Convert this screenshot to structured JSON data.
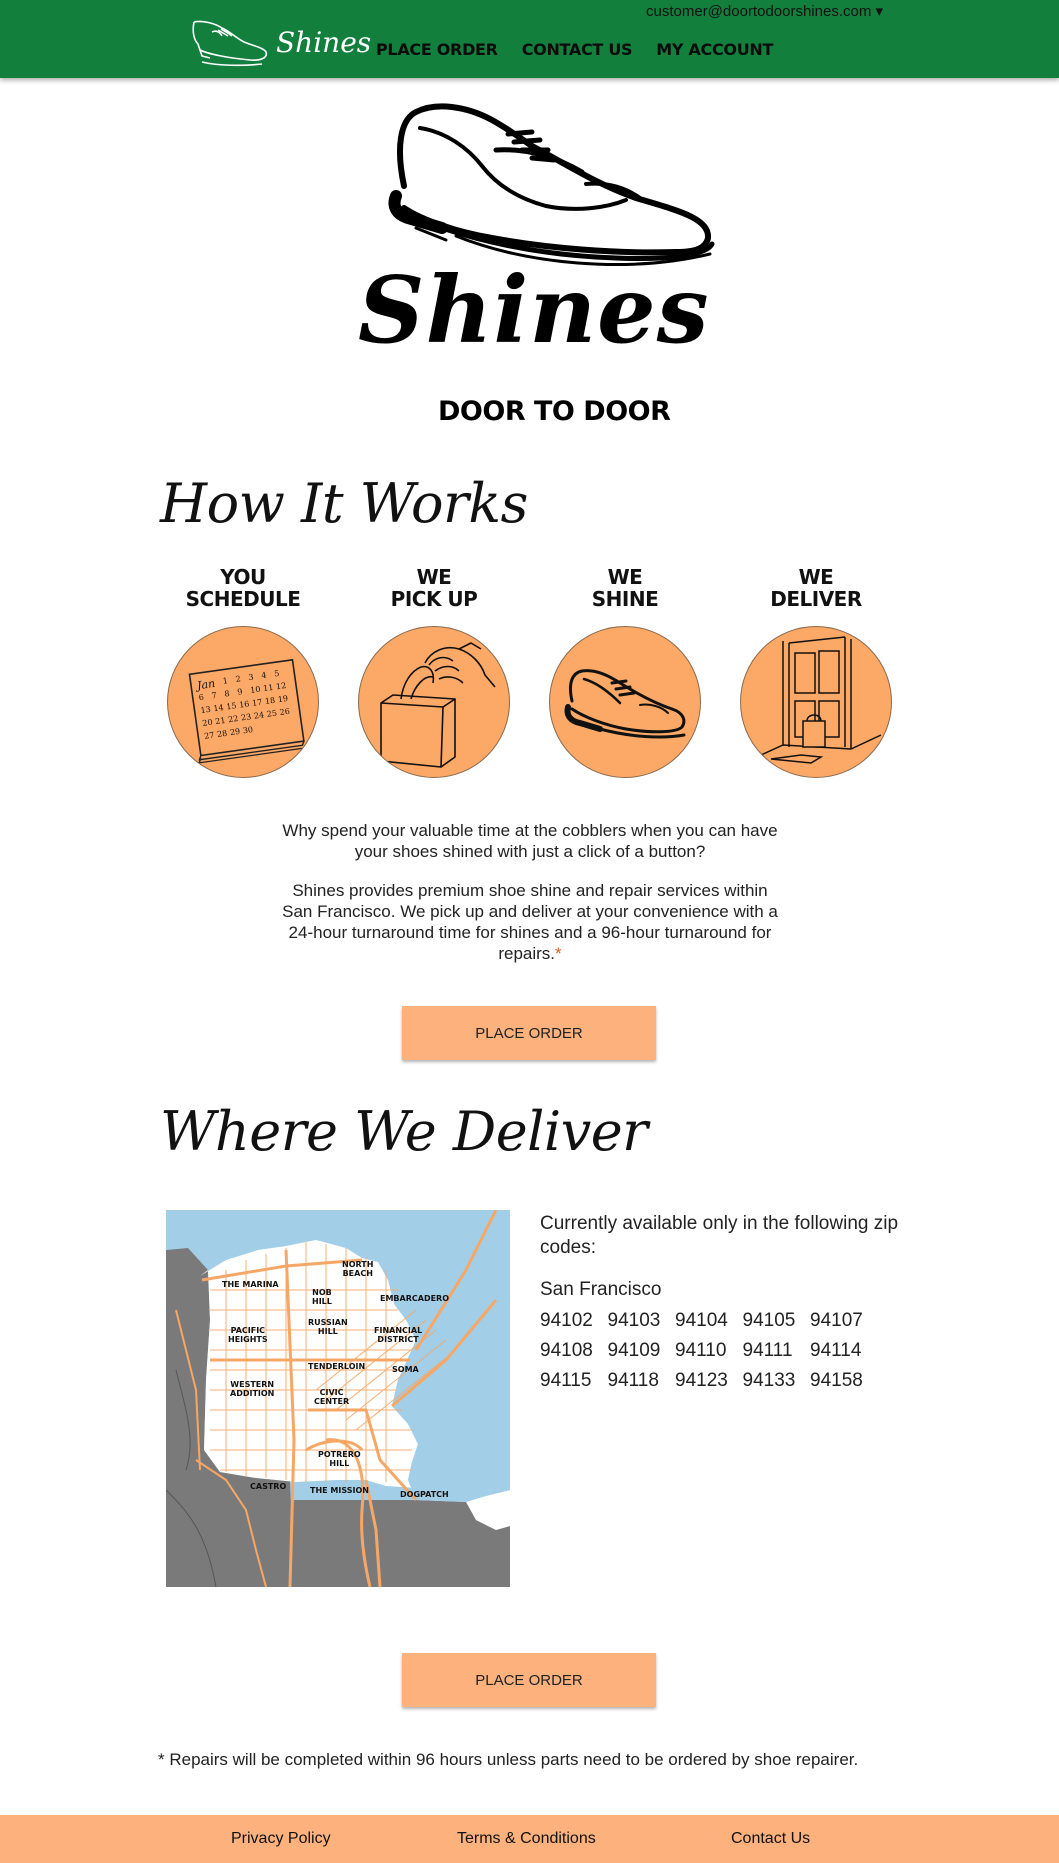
{
  "header": {
    "user_email": "customer@doortodoorshines.com ▾",
    "brand_name": "Shines",
    "nav": [
      "PLACE ORDER",
      "CONTACT US",
      "MY ACCOUNT"
    ]
  },
  "hero": {
    "title": "Shines",
    "subtitle": "DOOR TO DOOR"
  },
  "how_it_works": {
    "heading": "How It Works",
    "steps": [
      {
        "line1": "YOU",
        "line2": "SCHEDULE",
        "icon": "calendar-icon"
      },
      {
        "line1": "WE",
        "line2": "PICK UP",
        "icon": "bag-pickup-icon"
      },
      {
        "line1": "WE",
        "line2": "SHINE",
        "icon": "shoe-icon"
      },
      {
        "line1": "WE",
        "line2": "DELIVER",
        "icon": "door-delivery-icon"
      }
    ],
    "calendar": {
      "month": "Jan",
      "days": [
        "1",
        "2",
        "3",
        "4",
        "5",
        "6",
        "7",
        "8",
        "9",
        "10",
        "11",
        "12",
        "13",
        "14",
        "15",
        "16",
        "17",
        "18",
        "19",
        "20",
        "21",
        "22",
        "23",
        "24",
        "25",
        "26",
        "27",
        "28",
        "29",
        "30"
      ]
    },
    "paragraph1": "Why spend your valuable time at the cobblers when you can have your shoes shined with just a click of a button?",
    "paragraph2": "Shines provides premium shoe shine and repair services within San Francisco. We pick up and deliver at your convenience with a 24-hour turnaround time for shines and a 96-hour turnaround for repairs.",
    "asterisk": "*"
  },
  "place_order_label": "PLACE ORDER",
  "where_we_deliver": {
    "heading": "Where We Deliver",
    "map_labels": {
      "marina": "THE MARINA",
      "north_beach": "NORTH\nBEACH",
      "nob_hill": "NOB\nHILL",
      "embarcadero": "EMBARCADERO",
      "pacific_heights": "PACIFIC\nHEIGHTS",
      "russian_hill": "RUSSIAN\nHILL",
      "financial_district": "FINANCIAL\nDISTRICT",
      "tenderloin": "TENDERLOIN",
      "soma": "SOMA",
      "western_addition": "WESTERN\nADDITION",
      "civic_center": "CIVIC\nCENTER",
      "potrero_hill": "POTRERO\nHILL",
      "castro": "CASTRO",
      "mission": "THE MISSION",
      "dogpatch": "DOGPATCH"
    },
    "intro": "Currently available only in the following zip codes:",
    "city": "San Francisco",
    "zips": [
      "94102",
      "94103",
      "94104",
      "94105",
      "94107",
      "94108",
      "94109",
      "94110",
      "94111",
      "94114",
      "94115",
      "94118",
      "94123",
      "94133",
      "94158"
    ]
  },
  "footnote": "* Repairs will be completed within 96 hours unless parts need to be ordered by shoe repairer.",
  "footer": {
    "privacy": "Privacy Policy",
    "terms": "Terms & Conditions",
    "contact": "Contact Us"
  },
  "colors": {
    "header_green": "#127f3d",
    "accent_orange": "#fca866",
    "button_orange": "#fdb17c",
    "map_water": "#a2cfe7",
    "map_land_gray": "#7a7a7a"
  }
}
